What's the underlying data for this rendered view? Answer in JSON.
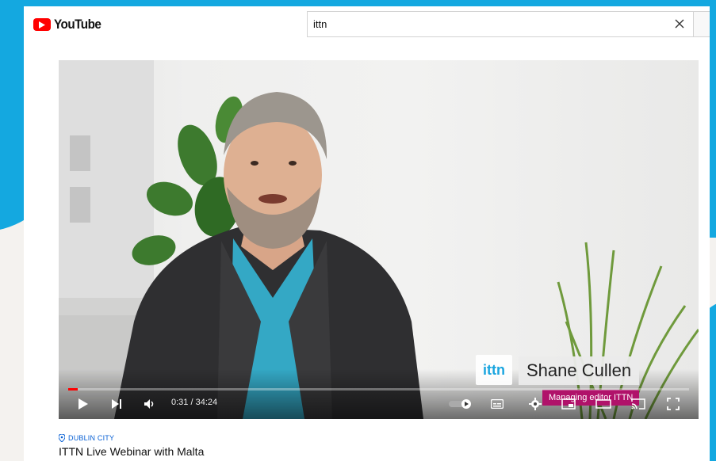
{
  "header": {
    "logo_text": "YouTube",
    "search_value": "ittn",
    "clear_icon": "close-icon"
  },
  "player": {
    "time_display": "0:31 / 34:24",
    "progress_fraction": 0.015,
    "lower_third": {
      "logo_text": "ittn",
      "name": "Shane Cullen",
      "role": "Managing editor ITTN"
    },
    "controls": [
      "play-icon",
      "next-icon",
      "volume-icon",
      "autoplay-toggle-icon",
      "subtitles-icon",
      "settings-icon",
      "miniplayer-icon",
      "theater-mode-icon",
      "cast-icon",
      "fullscreen-icon"
    ]
  },
  "video_info": {
    "location": "DUBLIN CITY",
    "title": "ITTN Live Webinar with Malta"
  },
  "colors": {
    "brand_red": "#ff0000",
    "background_blue": "#14a8e0",
    "link_blue": "#065fd4",
    "lower_third_magenta": "#b0126a"
  }
}
